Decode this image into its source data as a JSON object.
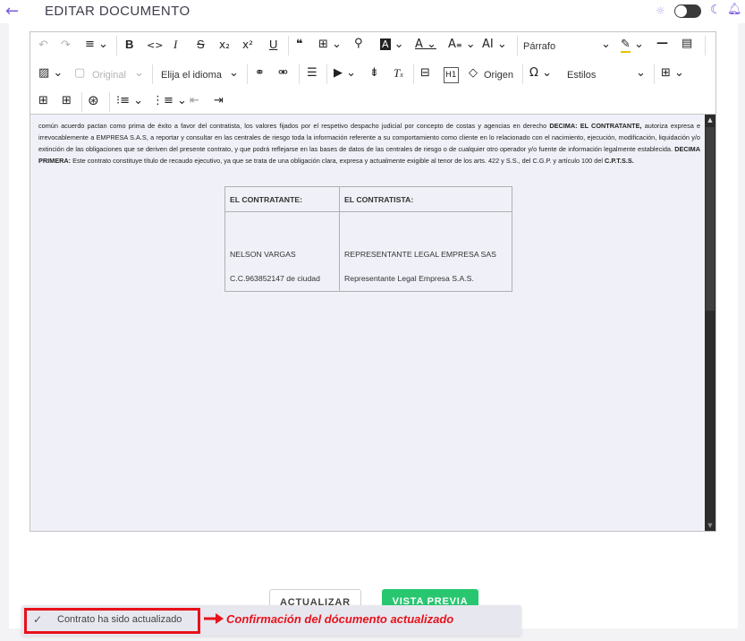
{
  "header": {
    "title": "EDITAR DOCUMENTO",
    "back_icon": "arrow-left-icon",
    "sun_icon": "sun-icon",
    "moon_icon": "moon-icon",
    "bell_icon": "bell-icon",
    "theme_toggle": "dark"
  },
  "toolbar": {
    "row1": [
      {
        "name": "undo-icon",
        "glyph": "↶",
        "dim": true
      },
      {
        "name": "redo-icon",
        "glyph": "↷",
        "dim": true
      },
      {
        "name": "align-icon",
        "glyph": "≡⌄"
      },
      {
        "name": "bold-icon",
        "glyph": "B"
      },
      {
        "name": "code-icon",
        "glyph": "<>"
      },
      {
        "name": "italic-icon",
        "glyph": "I"
      },
      {
        "name": "strikethrough-icon",
        "glyph": "S"
      },
      {
        "name": "subscript-icon",
        "glyph": "x₂"
      },
      {
        "name": "superscript-icon",
        "glyph": "x²"
      },
      {
        "name": "underline-icon",
        "glyph": "U"
      },
      {
        "name": "blockquote-icon",
        "glyph": "❝"
      },
      {
        "name": "find-replace-icon",
        "glyph": "⊞⌄"
      },
      {
        "name": "search-icon",
        "glyph": "⚲"
      },
      {
        "name": "highlight-icon",
        "glyph": "A⌄"
      },
      {
        "name": "font-color-icon",
        "glyph": "A⌄"
      },
      {
        "name": "font-size-icon",
        "glyph": "A⌄"
      },
      {
        "name": "font-family-icon",
        "glyph": "AI⌄"
      }
    ],
    "heading_select": "Párrafo",
    "row1_right": [
      {
        "name": "marker-icon",
        "glyph": "✎⌄"
      },
      {
        "name": "horizontal-line-icon",
        "glyph": "—"
      },
      {
        "name": "html-embed-icon",
        "glyph": "▤"
      }
    ],
    "row2": [
      {
        "name": "insert-image-icon",
        "glyph": "▨⌄"
      },
      {
        "name": "image-original-icon",
        "glyph": "▢",
        "dim": true
      }
    ],
    "image_size_select": "Original",
    "language_select": "Elija el idioma",
    "row2_mid": [
      {
        "name": "link-icon",
        "glyph": "⚭"
      },
      {
        "name": "unlink-icon",
        "glyph": "⚮"
      },
      {
        "name": "todo-list-icon",
        "glyph": "☰"
      },
      {
        "name": "media-embed-icon",
        "glyph": "▶⌄"
      },
      {
        "name": "page-break-icon",
        "glyph": "⇟"
      },
      {
        "name": "remove-format-icon",
        "glyph": "Tx"
      },
      {
        "name": "show-blocks-icon",
        "glyph": "⊟"
      },
      {
        "name": "heading-h1-icon",
        "glyph": "H1"
      },
      {
        "name": "source-icon",
        "glyph": "◇"
      }
    ],
    "source_label": "Origen",
    "special_chars_glyph": "Ω⌄",
    "styles_select": "Estilos",
    "table_glyph": "⊞⌄",
    "row3": [
      {
        "name": "insert-table-icon",
        "glyph": "⊞"
      },
      {
        "name": "table-properties-icon",
        "glyph": "⊞"
      },
      {
        "name": "accessibility-icon",
        "glyph": "⊛"
      },
      {
        "name": "bulleted-list-icon",
        "glyph": "⁝≡⌄"
      },
      {
        "name": "numbered-list-icon",
        "glyph": "⋮≡⌄"
      },
      {
        "name": "outdent-icon",
        "glyph": "⇤"
      },
      {
        "name": "indent-icon",
        "glyph": "⇥"
      }
    ]
  },
  "document": {
    "p1_a": "común acuerdo pactan como prima de éxito a favor del contratista, los valores fijados por el respetivo despacho judicial por concepto de costas y agencias en derecho ",
    "p1_b1": "DECIMA: EL CONTRATANTE,",
    "p1_c": " autoriza expresa e irrevocablemente a EMPRESA S.A.S, a reportar y consultar en las centrales de riesgo toda la información referente a su comportamiento como cliente en lo relacionado con el nacimiento, ejecución, modificación, liquidación y/o extinción de las obligaciones que se deriven del presente contrato, y que podrá reflejarse en las bases de datos de las centrales de riesgo o de cualquier otro operador y/o fuente de información legalmente establecida. ",
    "p1_b2": "DECIMA PRIMERA:",
    "p1_d": " Este contrato constituye título de recaudo ejecutivo, ya que se trata de una obligación clara, expresa y actualmente exigible al tenor de los arts. 422 y S.S., del C.G.P. y artículo 100 del ",
    "p1_b3": "C.P.T.S.S."
  },
  "signatures": {
    "contratante_header": "EL CONTRATANTE:",
    "contratista_header": "EL CONTRATISTA:",
    "contratante_name": "NELSON VARGAS",
    "contratante_id": "C.C.963852147 de ciudad",
    "contratista_name": "REPRESENTANTE LEGAL EMPRESA SAS",
    "contratista_role": "Representante Legal Empresa S.A.S."
  },
  "actions": {
    "update_label": "ACTUALIZAR",
    "preview_label": "VISTA PREVIA"
  },
  "toast": {
    "check_icon": "check-icon",
    "message": "Contrato ha sido actualizado"
  },
  "annotation": {
    "label": "Confirmación del dócumento actualizado",
    "color": "#e8111a"
  },
  "colors": {
    "accent": "#7c5ce0",
    "preview_button": "#28c76f",
    "annotation": "#e8111a"
  }
}
